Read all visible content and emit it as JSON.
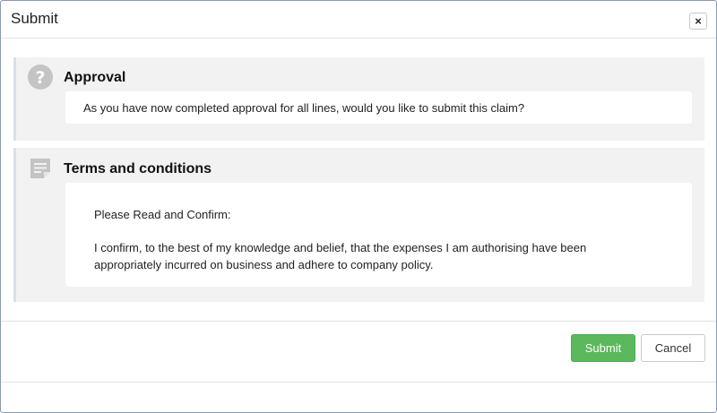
{
  "dialog": {
    "title": "Submit",
    "close_label": "×"
  },
  "approval": {
    "icon": "question-circle-icon",
    "title": "Approval",
    "message": "As you have now completed approval for all lines, would you like to submit this claim?"
  },
  "terms": {
    "icon": "document-lines-icon",
    "title": "Terms and conditions",
    "heading": "Please Read and Confirm:",
    "body": "I confirm, to the best of my knowledge and belief, that the expenses I am authorising have been appropriately incurred on business and adhere to company policy."
  },
  "footer": {
    "submit_label": "Submit",
    "cancel_label": "Cancel"
  },
  "colors": {
    "submit_bg": "#5cb85c",
    "panel_bg": "#f2f2f2",
    "panel_accent": "#d6e1ef"
  }
}
